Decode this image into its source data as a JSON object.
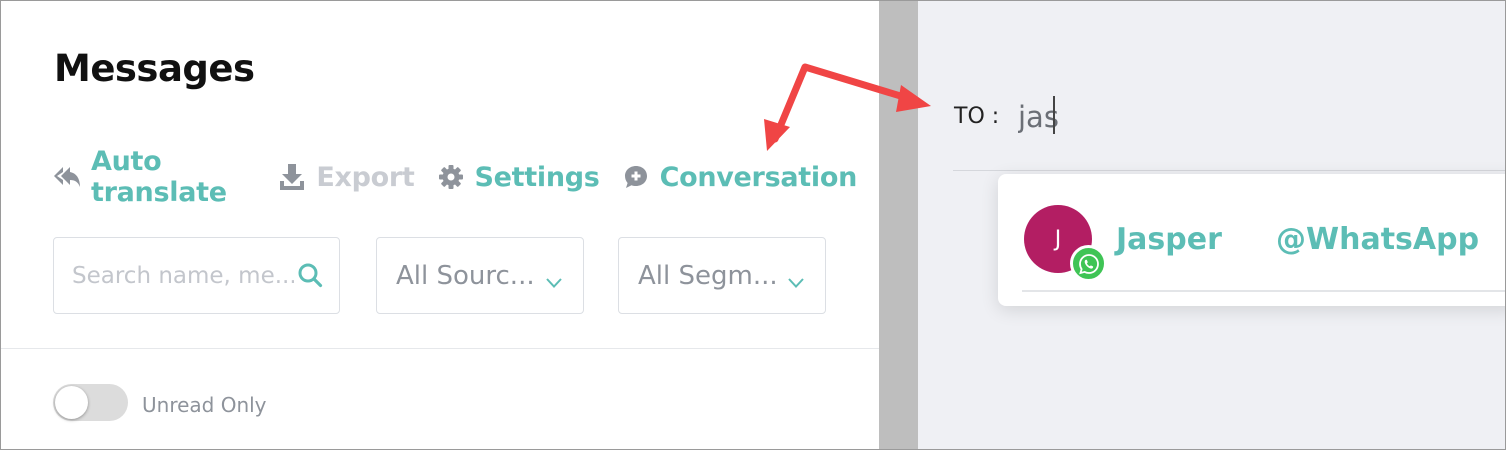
{
  "left_panel": {
    "title": "Messages",
    "actions": [
      {
        "label": "Auto translate",
        "icon": "reply-all-icon",
        "enabled": true
      },
      {
        "label": "Export",
        "icon": "download-icon",
        "enabled": false
      },
      {
        "label": "Settings",
        "icon": "gear-icon",
        "enabled": true
      },
      {
        "label": "Conversation",
        "icon": "chat-plus-icon",
        "enabled": true
      }
    ],
    "search": {
      "placeholder": "Search name, me..."
    },
    "source_filter": {
      "value": "All Sourc..."
    },
    "segment_filter": {
      "value": "All Segm..."
    },
    "unread_toggle": {
      "label": "Unread Only",
      "on": false
    }
  },
  "right_panel": {
    "to_label": "TO :",
    "to_value": "jas",
    "suggestions": [
      {
        "avatar_letter": "J",
        "name": "Jasper",
        "channel": "@WhatsApp",
        "channel_icon": "whatsapp-icon"
      }
    ]
  },
  "colors": {
    "accent": "#5cbdb5",
    "disabled": "#c9ccd2",
    "avatar": "#b31e63",
    "whatsapp": "#3fc455",
    "annotation_arrow": "#f04545",
    "right_background": "#eff0f4",
    "separator": "#bebebe"
  }
}
